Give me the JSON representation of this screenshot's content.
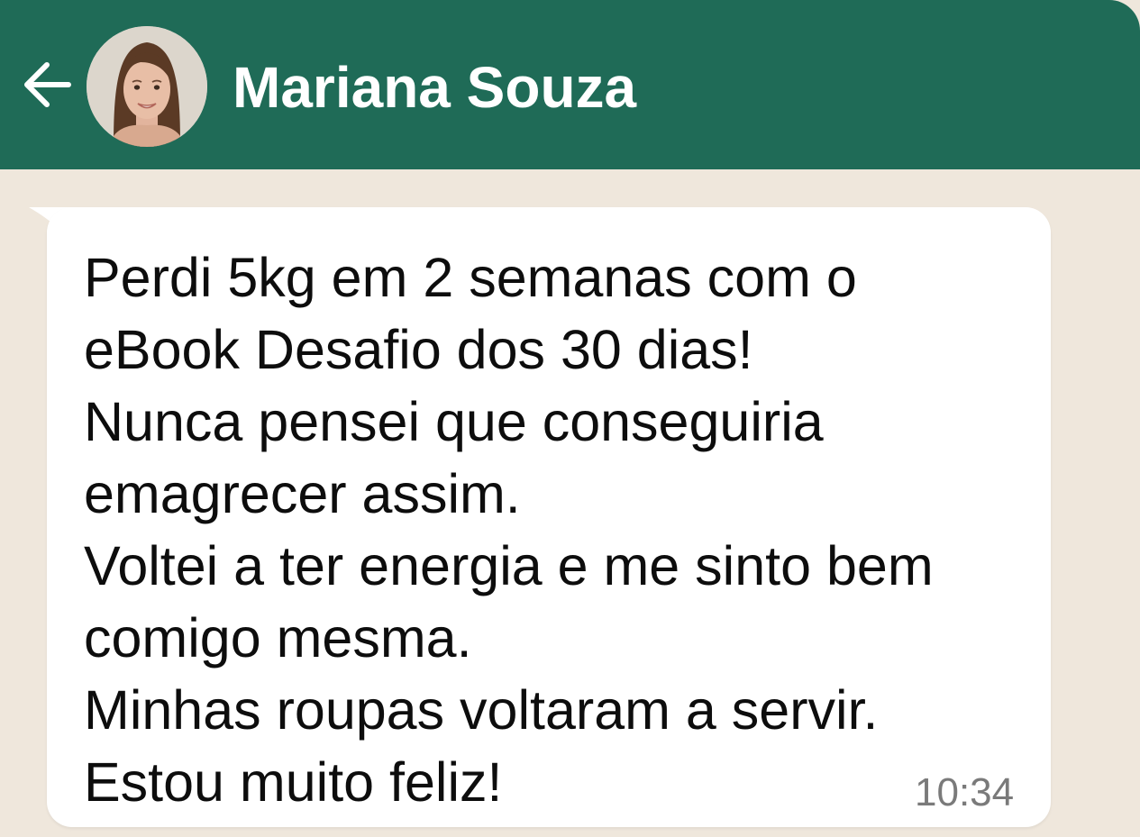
{
  "header": {
    "back_icon": "arrow-left-icon",
    "contact_name": "Mariana Souza",
    "background_color": "#1f6b57"
  },
  "chat": {
    "background_color": "#efe7dc",
    "message": {
      "lines": [
        "Perdi 5kg em 2 semanas com o",
        "eBook Desafio dos 30 dias!",
        "Nunca pensei que conseguiria",
        "emagrecer assim.",
        "Voltei a ter energia e me sinto bem",
        "comigo mesma.",
        "Minhas roupas voltaram a servir.",
        "Estou muito feliz!"
      ],
      "time": "10:34",
      "bubble_color": "#ffffff"
    }
  }
}
